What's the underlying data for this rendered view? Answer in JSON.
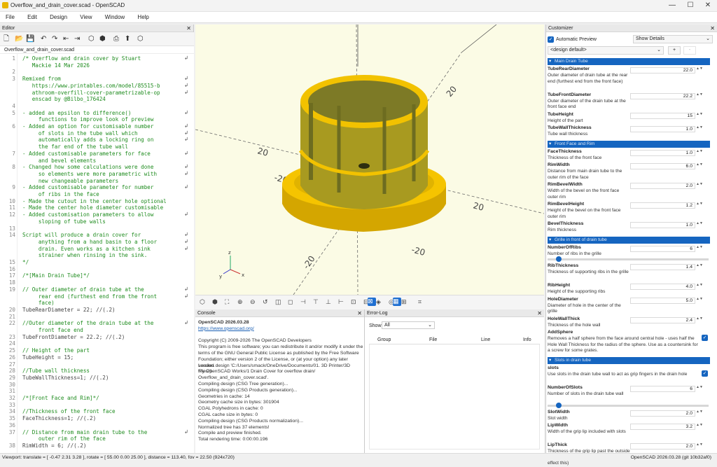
{
  "window": {
    "title": "Overflow_and_drain_cover.scad - OpenSCAD",
    "min": "—",
    "max": "☐",
    "close": "✕"
  },
  "menu": [
    "File",
    "Edit",
    "Design",
    "View",
    "Window",
    "Help"
  ],
  "editor": {
    "title": "Editor",
    "close": "✕",
    "tab": "Overflow_and_drain_cover.scad",
    "toolbar_icons": [
      "new-file-icon",
      "open-file-icon",
      "save-icon",
      "save-all-icon",
      "undo-icon",
      "redo-icon",
      "unindent-icon",
      "indent-icon",
      "preview-icon",
      "render-icon",
      "export-icon",
      "send-icon"
    ],
    "lines": [
      {
        "n": "1",
        "t": "/* Overflow and drain cover by Stuart",
        "c": true,
        "w": true
      },
      {
        "n": "",
        "t": "   Mackie 14 Mar 2026",
        "c": true
      },
      {
        "n": "2",
        "t": "",
        "c": true
      },
      {
        "n": "3",
        "t": "Remixed from",
        "c": true,
        "w": true
      },
      {
        "n": "",
        "t": "   https://www.printables.com/model/85515-b",
        "c": true,
        "w": true
      },
      {
        "n": "",
        "t": "   athroom-overfill-cover-parametrizable-op",
        "c": true,
        "w": true
      },
      {
        "n": "",
        "t": "   enscad by @Bilbo_176424",
        "c": true
      },
      {
        "n": "4",
        "t": "",
        "c": true
      },
      {
        "n": "5",
        "t": "- added an epsilon to difference()",
        "c": true,
        "w": true
      },
      {
        "n": "",
        "t": "     functions to improve look of preview",
        "c": true
      },
      {
        "n": "6",
        "t": "- Added an option for customisable number",
        "c": true,
        "w": true
      },
      {
        "n": "",
        "t": "     of slots in the tube wall which",
        "c": true,
        "w": true
      },
      {
        "n": "",
        "t": "     automatically adds a locking ring on",
        "c": true,
        "w": true
      },
      {
        "n": "",
        "t": "     the far end of the tube wall",
        "c": true
      },
      {
        "n": "7",
        "t": "- Added customisable parameters for face",
        "c": true,
        "w": true
      },
      {
        "n": "",
        "t": "     and bevel elements",
        "c": true
      },
      {
        "n": "8",
        "t": "- Changed how some calculations were done",
        "c": true,
        "w": true
      },
      {
        "n": "",
        "t": "     so elements were more parametric with",
        "c": true,
        "w": true
      },
      {
        "n": "",
        "t": "     new changeable parameters",
        "c": true
      },
      {
        "n": "9",
        "t": "- Added customisable parameter for number",
        "c": true,
        "w": true
      },
      {
        "n": "",
        "t": "     of ribs in the face",
        "c": true
      },
      {
        "n": "10",
        "t": "- Made the cutout in the center hole optional",
        "c": true
      },
      {
        "n": "11",
        "t": "- Made the center hole diameter customisable",
        "c": true
      },
      {
        "n": "12",
        "t": "- Added customisation parameters to allow",
        "c": true,
        "w": true
      },
      {
        "n": "",
        "t": "     sloping of tube walls",
        "c": true
      },
      {
        "n": "13",
        "t": "",
        "c": true
      },
      {
        "n": "14",
        "t": "Script will produce a drain cover for",
        "c": true,
        "w": true
      },
      {
        "n": "",
        "t": "     anything from a hand basin to a floor",
        "c": true,
        "w": true
      },
      {
        "n": "",
        "t": "     drain. Even works as a kitchen sink",
        "c": true,
        "w": true
      },
      {
        "n": "",
        "t": "     strainer when rinsing in the sink.",
        "c": true
      },
      {
        "n": "15",
        "t": "*/",
        "c": true
      },
      {
        "n": "16",
        "t": "",
        "c": false
      },
      {
        "n": "17",
        "t": "/*[Main Drain Tube]*/",
        "c": true
      },
      {
        "n": "18",
        "t": "",
        "c": false
      },
      {
        "n": "19",
        "t": "// Outer diameter of drain tube at the",
        "c": true,
        "w": true
      },
      {
        "n": "",
        "t": "     rear end (furthest end from the front",
        "c": true,
        "w": true
      },
      {
        "n": "",
        "t": "     face)",
        "c": true
      },
      {
        "n": "20",
        "t": "TubeRearDiameter = 22; //(.2)",
        "c": false
      },
      {
        "n": "21",
        "t": "",
        "c": false
      },
      {
        "n": "22",
        "t": "//Outer diameter of the drain tube at the",
        "c": true,
        "w": true
      },
      {
        "n": "",
        "t": "     front face end",
        "c": true
      },
      {
        "n": "23",
        "t": "TubeFrontDiameter = 22.2; //(.2)",
        "c": false
      },
      {
        "n": "24",
        "t": "",
        "c": false
      },
      {
        "n": "25",
        "t": "// Height of the part",
        "c": true
      },
      {
        "n": "26",
        "t": "TubeHeight = 15;",
        "c": false
      },
      {
        "n": "27",
        "t": "",
        "c": false
      },
      {
        "n": "28",
        "t": "//Tube wall thickness",
        "c": true
      },
      {
        "n": "29",
        "t": "TubeWallThickness=1; //(.2)",
        "c": false
      },
      {
        "n": "30",
        "t": "",
        "c": false
      },
      {
        "n": "31",
        "t": "",
        "c": false
      },
      {
        "n": "32",
        "t": "/*[Front Face and Rim]*/",
        "c": true
      },
      {
        "n": "33",
        "t": "",
        "c": false
      },
      {
        "n": "34",
        "t": "//Thickness of the front face",
        "c": true
      },
      {
        "n": "35",
        "t": "FaceThickness=1; //(.2)",
        "c": false
      },
      {
        "n": "36",
        "t": "",
        "c": false
      },
      {
        "n": "37",
        "t": "// Distance from main drain tube to the",
        "c": true,
        "w": true
      },
      {
        "n": "",
        "t": "     outer rim of the face",
        "c": true
      },
      {
        "n": "38",
        "t": "RimWidth = 6; //(.2)",
        "c": false
      }
    ]
  },
  "viewport": {
    "axis_labels": [
      "20",
      "20",
      "20",
      "-20",
      "-20",
      "-20"
    ],
    "model_color": "#f2c200"
  },
  "viewtool_icons": [
    "preview-icon",
    "render-icon",
    "view-all-icon",
    "zoom-in-icon",
    "zoom-out-icon",
    "reset-view-icon",
    "perspective-icon",
    "orthogonal-icon",
    "view-right-icon",
    "view-top-icon",
    "view-bottom-icon",
    "view-left-icon",
    "view-front-icon",
    "view-back-icon",
    "view-diagonal-icon",
    "view-center-icon",
    "show-axes-icon",
    "show-scale-icon",
    "show-edges-icon",
    "crosshair-icon"
  ],
  "console": {
    "title": "Console",
    "close": "✕",
    "lines": [
      "OpenSCAD 2026.03.28",
      "https://www.openscad.org/",
      "",
      "Copyright (C) 2009-2026 The OpenSCAD Developers",
      "This program is free software; you can redistribute it and/or modify it under the",
      "terms of the GNU General Public License as published by the Free Software",
      "Foundation; either version 2 of the License, or (at your option) any later version.",
      "Loaded design 'C:/Users/smack/OneDrive/Documents/01. 3D Printer/3D Files/1",
      "My OpenSCAD Works/1 Drain Cover for overflow drain/",
      "Overflow_and_drain_cover.scad'.",
      "Compiling design (CSG Tree generation)...",
      "Compiling design (CSG Products generation)...",
      "Geometries in cache: 14",
      "Geometry cache size in bytes: 301904",
      "CGAL Polyhedrons in cache: 0",
      "CGAL cache size in bytes: 0",
      "Compiling design (CSG Products normalization)...",
      "Normalized tree has 37 elements!",
      "Compile and preview finished.",
      "Total rendering time: 0:00:00.196"
    ]
  },
  "errorlog": {
    "title": "Error-Log",
    "close": "✕",
    "show_label": "Show",
    "show_value": "All",
    "columns": [
      "Group",
      "File",
      "Line",
      "Info"
    ]
  },
  "customizer": {
    "title": "Customizer",
    "close": "✕",
    "auto_preview": "Automatic Preview",
    "details": "Show Details",
    "preset": "<design default>",
    "add": "+",
    "remove": "-",
    "groups": [
      {
        "name": "Main Drain Tube",
        "params": [
          {
            "n": "TubeRearDiameter",
            "d": "Outer diameter of drain tube at the rear end (furthest end from the front face)",
            "v": "22.0"
          },
          {
            "n": "TubeFrontDiameter",
            "d": "Outer diameter of the drain tube at the front face end",
            "v": "22.2"
          },
          {
            "n": "TubeHeight",
            "d": "Height of the part",
            "v": "15"
          },
          {
            "n": "TubeWallThickness",
            "d": "Tube wall thickness",
            "v": "1.0"
          }
        ]
      },
      {
        "name": "Front Face and Rim",
        "params": [
          {
            "n": "FaceThickness",
            "d": "Thickness of the front face",
            "v": "1.0"
          },
          {
            "n": "RimWidth",
            "d": "Distance from main drain tube to the outer rim of the face",
            "v": "6.0"
          },
          {
            "n": "RimBevelWidth",
            "d": "Width of the bevel on the front face outer rim",
            "v": "2.0"
          },
          {
            "n": "RimBevelHeight",
            "d": "Height of the bevel on the front face outer rim",
            "v": "1.2"
          },
          {
            "n": "BevelThickness",
            "d": "Rim thickness",
            "v": "1.0"
          }
        ]
      },
      {
        "name": "Grille in front of drain tube",
        "params": [
          {
            "n": "NumberOfRibs",
            "d": "Number of ribs in the grille",
            "v": "6",
            "slider": 0.05
          },
          {
            "n": "RibThickness",
            "d": "Thickness of supporting ribs in the grille",
            "v": "1.4"
          },
          {
            "n": "RibHeight",
            "d": "Height of the supporting ribs",
            "v": "4.0"
          },
          {
            "n": "HoleDiameter",
            "d": "Diameter of hole in the center of the grille",
            "v": "5.0"
          },
          {
            "n": "HoleWallThick",
            "d": "Thickness of the hole wall",
            "v": "2.4"
          },
          {
            "n": "AddSphere",
            "d": "Removes a half sphere from the face around central hole - uses half the Hole Wall Thickness for the radius of the sphere. Use as a countersink for a screw for some grates.",
            "check": true
          }
        ]
      },
      {
        "name": "Slots in drain tube",
        "params": [
          {
            "n": "slots",
            "d": "Use slots in the drain tube wall to act as grip fingers in the drain hole",
            "check": true
          },
          {
            "n": "NumberOfSlots",
            "d": "Number of slots in the drain tube wall",
            "v": "6",
            "slider": 0.05
          },
          {
            "n": "SlotWidth",
            "d": "Slot width",
            "v": "2.0"
          },
          {
            "n": "LipWidth",
            "d": "Width of the grip lip included with slots",
            "v": "3.2"
          },
          {
            "n": "LipThick",
            "d": "Thickness of the grip lip past the outside of the drain tube (angle of the tube will effect this)",
            "v": "2.0"
          }
        ]
      }
    ]
  },
  "status": {
    "left": "Viewport: translate = [ -0.47 2.31 3.28 ], rotate = [ 55.00 0.00 25.00 ], distance = 113.40, fov = 22.50 (924x720)",
    "right": "OpenSCAD 2026.03.28 (git 10b32af0)"
  }
}
